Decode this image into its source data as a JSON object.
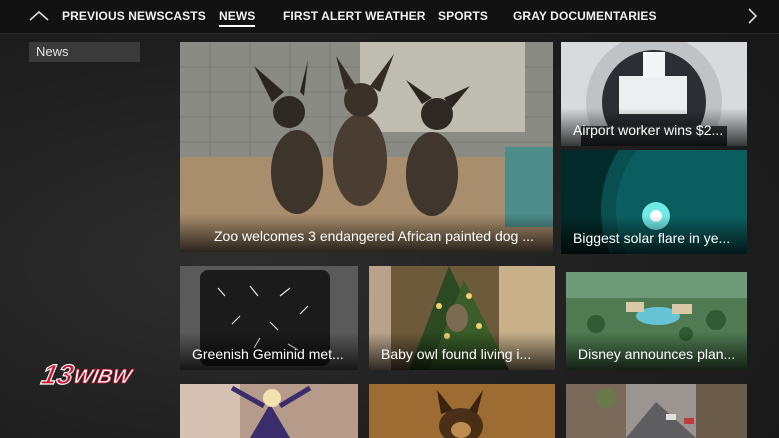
{
  "nav": {
    "items": [
      "PREVIOUS NEWSCASTS",
      "NEWS",
      "FIRST ALERT WEATHER",
      "SPORTS",
      "GRAY DOCUMENTARIES"
    ],
    "active": "NEWS",
    "up_icon": "chevron-up-icon",
    "next_icon": "chevron-right-icon"
  },
  "sidebar": {
    "items": [
      {
        "label": "News"
      }
    ]
  },
  "logo": {
    "text": "13WIBW",
    "color": "#c8102e"
  },
  "cards": [
    {
      "title": "Zoo welcomes 3 endangered African painted dog ...",
      "thumb": "painted-dog-puppies"
    },
    {
      "title": "Airport worker wins $2...",
      "thumb": "airport-scanner"
    },
    {
      "title": "Biggest solar flare in ye...",
      "thumb": "solar-flare"
    },
    {
      "title": "Greenish Geminid met...",
      "thumb": "meteor-shower"
    },
    {
      "title": "Baby owl found living i...",
      "thumb": "christmas-tree-owl"
    },
    {
      "title": "Disney announces plan...",
      "thumb": "resort-aerial"
    },
    {
      "title": "",
      "thumb": "performer-on-stage"
    },
    {
      "title": "",
      "thumb": "german-shepherd"
    },
    {
      "title": "",
      "thumb": "city-street"
    }
  ],
  "colors": {
    "background": "#1f1f1f",
    "topbar": "#121212",
    "sidebar_selected": "#3a3a3a",
    "text": "#ffffff"
  }
}
